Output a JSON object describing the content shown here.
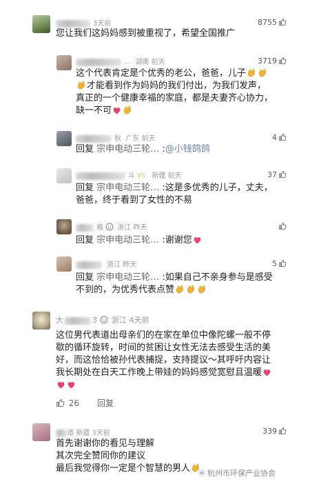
{
  "comments": [
    {
      "time": "3天前",
      "likes": "8755",
      "text": "您让我们这妈妈感到被重视了，希望全国推广"
    },
    {
      "name_suffix": "…",
      "location": "湖南",
      "time": "前天",
      "likes": "3719",
      "line1": "这个代表肯定是个优秀的老公，爸爸，儿子",
      "line2": "才能看到作为妈妈的我们付出，为我们发声，",
      "line3": "真正的一个健康幸福的家庭，都是夫妻齐心协力，",
      "line4": "缺一不可"
    },
    {
      "name_suffix": "秋",
      "location": "广东",
      "time": "前天",
      "likes": "4",
      "reply_kw": "回复",
      "reply_target": "宗申电动三轮…",
      "reply_sep": ":",
      "mention": "@小钱鸽鸽"
    },
    {
      "name_suffix": "斗",
      "location": "新疆",
      "time": "前天",
      "likes": "37",
      "reply_kw": "回复",
      "reply_target": "宗申电动三轮…",
      "line1": ":这是多优秀的儿子，丈夫，",
      "line2": "爸爸，终于看到了女性的不易"
    },
    {
      "name_suffix": "格",
      "location": "浙江",
      "time": "昨天",
      "reply_kw": "回复",
      "reply_target": "宗申电动三轮…",
      "line1": ":谢谢您"
    },
    {
      "location": "浙江",
      "time": "昨天",
      "likes": "5",
      "reply_kw": "回复",
      "reply_target": "宗申电动三轮…",
      "line1": ":如果自己不亲身参与是感受",
      "line2": "不到的，为优秀代表点赞"
    },
    {
      "name_prefix": "大",
      "name_suffix": "3",
      "location": "浙江",
      "time": "4天前",
      "line1": "这位男代表道出母亲们的在家在单位中像陀螺一般不停",
      "line2": "歇的循环旋转，时间的贫困让女性无法去感受生活的美",
      "line3": "好，而这恰恰被孙代表捕捉，支持提议～其呼吁内容让",
      "line4": "我长期处在白天工作晚上带娃的妈妈感觉宽慰且温暖",
      "likes": "26",
      "reply_label": "回复"
    },
    {
      "name_suffix": "道",
      "location": "新疆",
      "time": "3天前",
      "likes": "339",
      "line1": "首先谢谢你的看见与理解",
      "line2": "其次完全赞同你的建议",
      "line3": "最后我觉得你一定是个智慧的男人"
    }
  ],
  "watermark": "杭州市环保产业协会",
  "colors": {
    "link": "#6b7fa8",
    "heart": "#e8436a",
    "clap": "#f2b233"
  }
}
